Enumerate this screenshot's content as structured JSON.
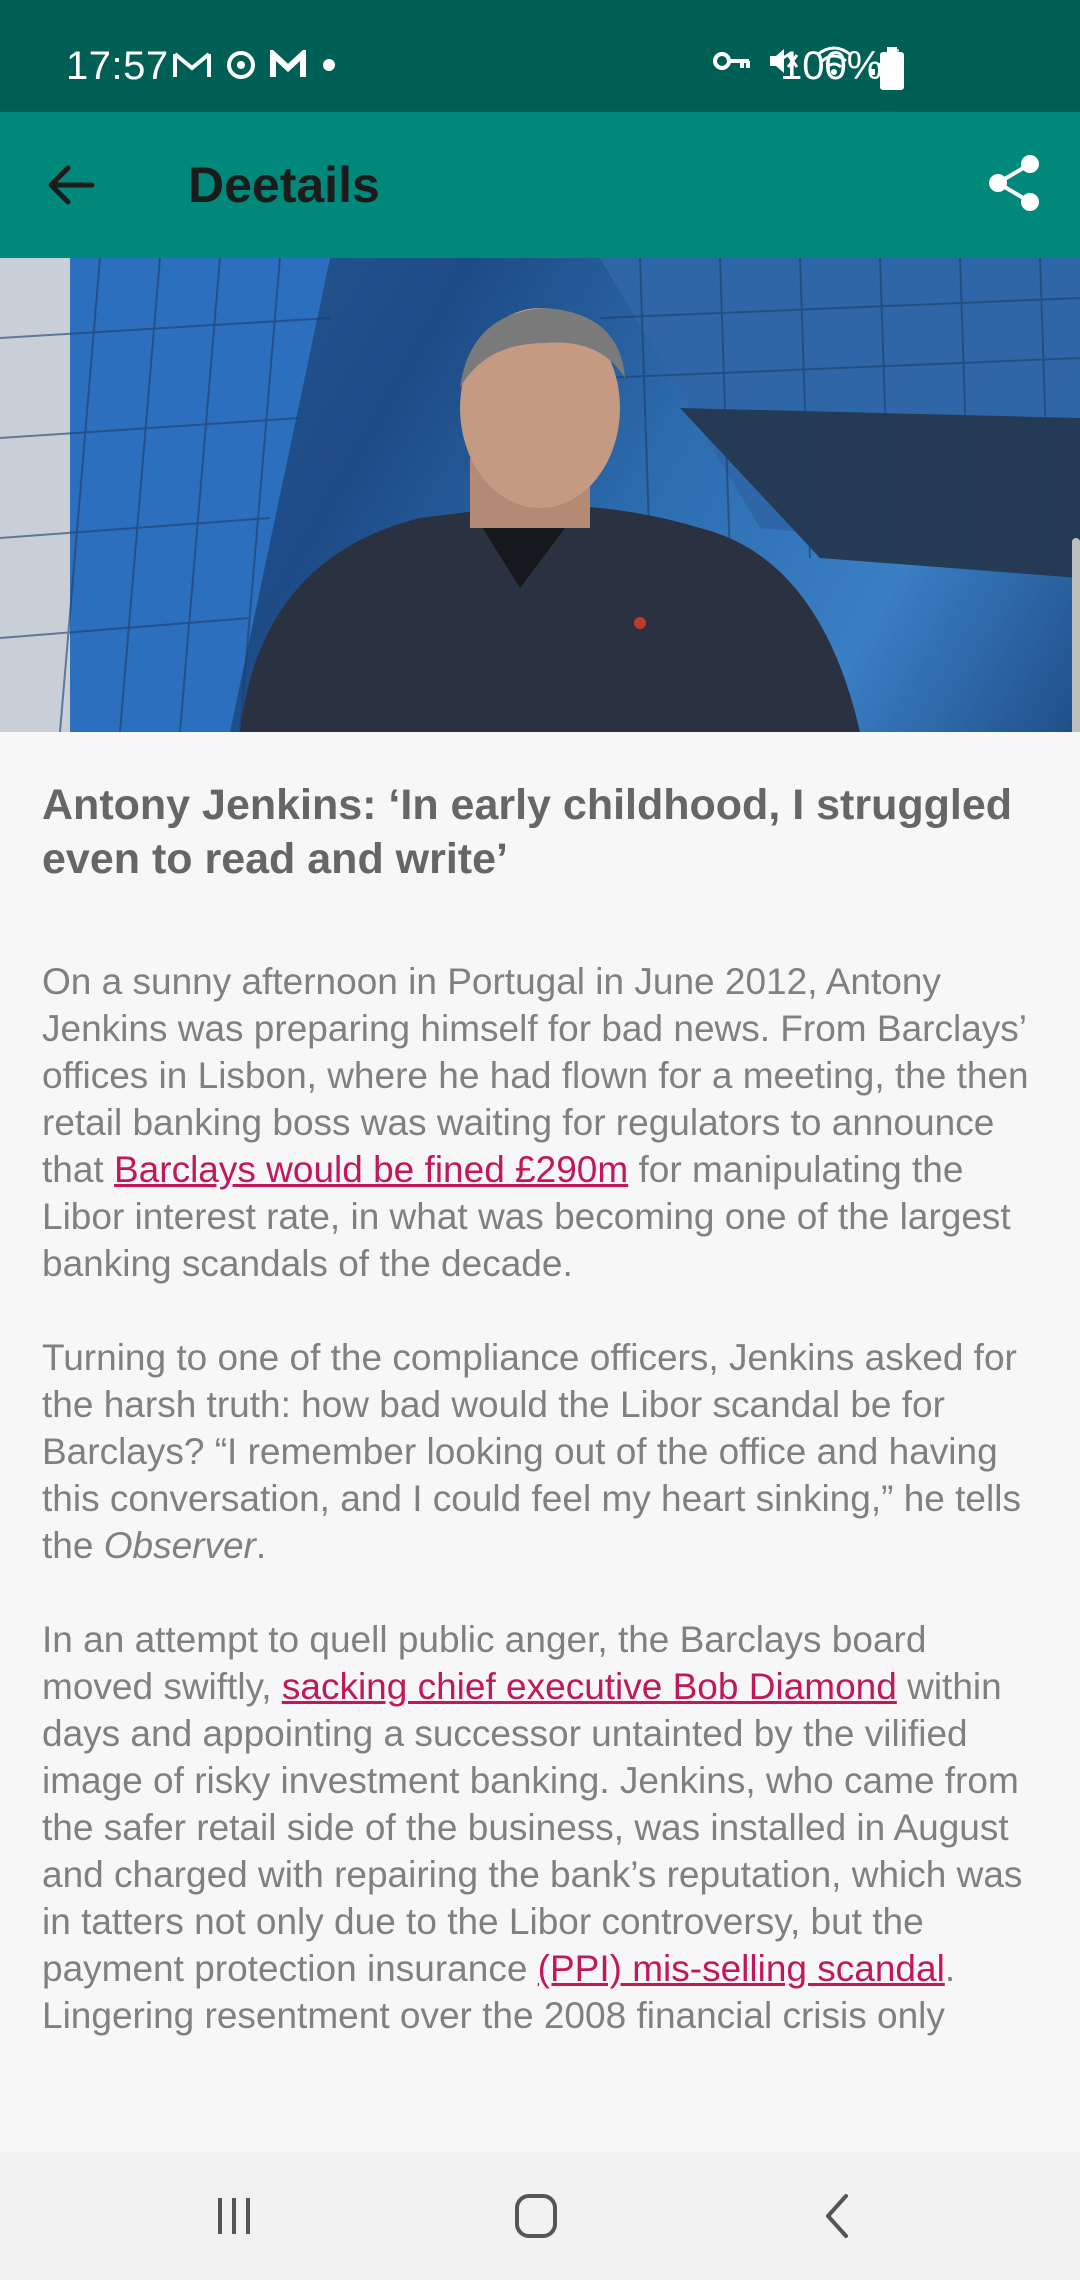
{
  "status_bar": {
    "time": "17:57",
    "battery": "100%",
    "left_icons": [
      "gmail-icon",
      "sync-icon",
      "m-app-icon",
      "dot-icon"
    ],
    "right_icons": [
      "vpn-key-icon",
      "mute-icon",
      "wifi-icon",
      "signal-icon"
    ]
  },
  "app_bar": {
    "title": "Deetails",
    "back_icon": "arrow-back-icon",
    "share_icon": "share-icon",
    "background": "#00897b"
  },
  "article": {
    "headline": "Antony Jenkins: ‘In early childhood, I struggled even to read and write’",
    "paragraphs": [
      {
        "before": "On a sunny afternoon in Portugal in June 2012, Antony Jenkins was preparing himself for bad news. From Barclays’ offices in Lisbon, where he had flown for a meeting, the then retail banking boss was waiting for regulators to announce that ",
        "link": "Barclays would be fined £290m",
        "after": " for manipulating the Libor interest rate, in what was becoming one of the largest banking scandals of the decade."
      },
      {
        "before": "Turning to one of the compliance officers, Jenkins asked for the harsh truth: how bad would the Libor scandal be for Barclays? “I remember looking out of the office and having this conversation, and I could feel my heart sinking,” he tells the ",
        "italic": "Observer",
        "after": "."
      },
      {
        "before": "In an attempt to quell public anger, the Barclays board moved swiftly, ",
        "link": "sacking chief executive Bob Diamond",
        "middle": " within days and appointing a successor untainted by the vilified image of risky investment banking. Jenkins, who came from the safer retail side of the business, was installed in August and charged with repairing the bank’s reputation, which was in tatters not only due to the Libor controversy, but the payment protection insurance ",
        "link2": "(PPI) mis-selling scandal",
        "after": ". Lingering resentment over the 2008 financial crisis only"
      }
    ],
    "link_color": "#c2185b"
  },
  "nav_bar": {
    "recents_icon": "recents-icon",
    "home_icon": "home-icon",
    "back_icon": "back-chevron-icon"
  }
}
